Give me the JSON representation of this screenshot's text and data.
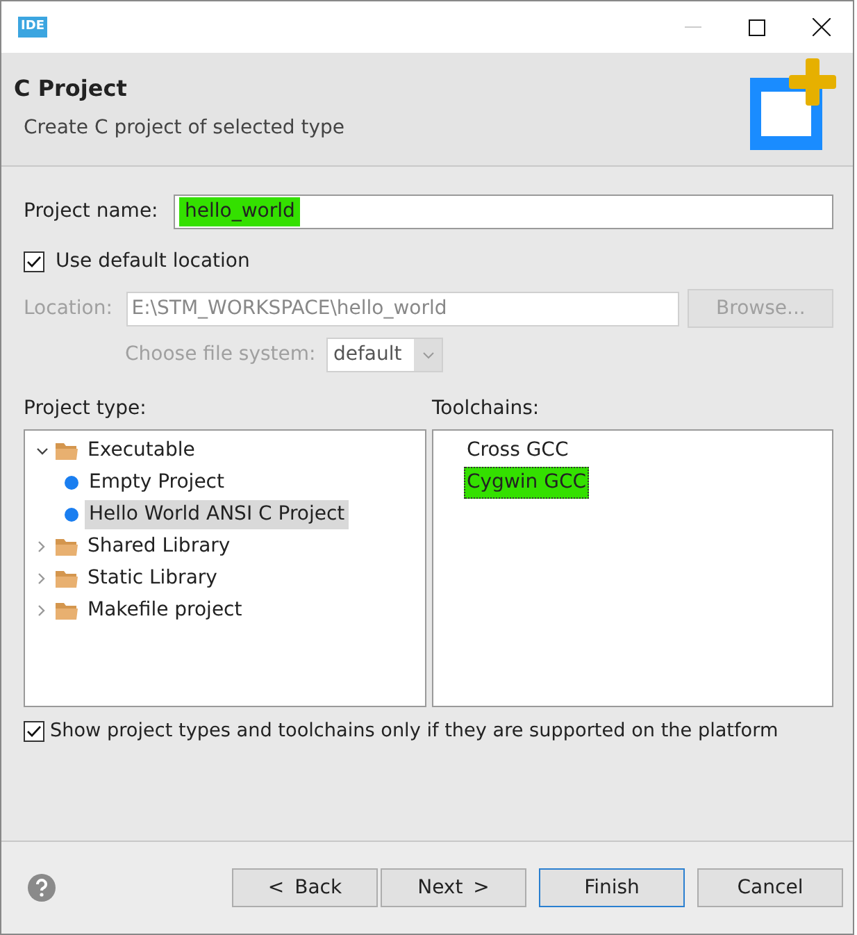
{
  "window": {
    "title_icon": "IDE"
  },
  "header": {
    "title": "C Project",
    "subtitle": "Create C project of selected type"
  },
  "project_name": {
    "label": "Project name:",
    "value": "hello_world",
    "highlighted": true
  },
  "use_default_location": {
    "label": "Use default location",
    "checked": true
  },
  "location": {
    "label": "Location:",
    "value": "E:\\STM_WORKSPACE\\hello_world",
    "disabled": true,
    "browse": {
      "label": "Browse..."
    }
  },
  "file_system": {
    "label": "Choose file system:",
    "value": "default",
    "disabled": true
  },
  "project_type": {
    "label": "Project type:",
    "items": [
      {
        "label": "Executable",
        "kind": "folder",
        "expanded": true,
        "children": [
          {
            "label": "Empty Project",
            "kind": "leaf",
            "selected": false
          },
          {
            "label": "Hello World ANSI C Project",
            "kind": "leaf",
            "selected": true
          }
        ]
      },
      {
        "label": "Shared Library",
        "kind": "folder",
        "expanded": false
      },
      {
        "label": "Static Library",
        "kind": "folder",
        "expanded": false
      },
      {
        "label": "Makefile project",
        "kind": "folder",
        "expanded": false
      }
    ]
  },
  "toolchains": {
    "label": "Toolchains:",
    "items": [
      {
        "label": "Cross GCC",
        "selected": false,
        "highlighted": false
      },
      {
        "label": "Cygwin GCC",
        "selected": true,
        "highlighted": true
      }
    ]
  },
  "show_supported": {
    "label": "Show project types and toolchains only if they are supported on the platform",
    "checked": true
  },
  "buttons": [
    {
      "label": "< Back",
      "default": false
    },
    {
      "label": "Next >",
      "default": false
    },
    {
      "label": "Finish",
      "default": true
    },
    {
      "label": "Cancel",
      "default": false
    }
  ]
}
